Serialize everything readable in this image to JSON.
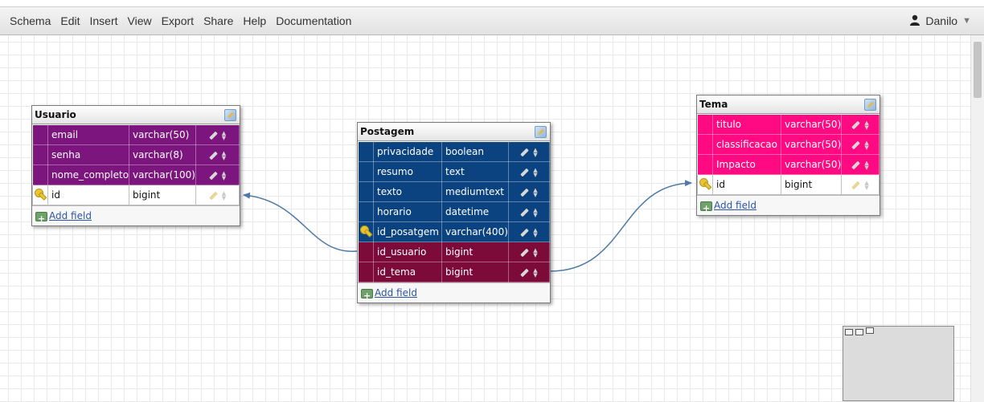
{
  "menu": {
    "items": [
      "Schema",
      "Edit",
      "Insert",
      "View",
      "Export",
      "Share",
      "Help",
      "Documentation"
    ],
    "user_name": "Danilo",
    "user_icon": "user-icon",
    "caret_icon": "caret-down-icon"
  },
  "colors": {
    "usuario_rows": "#7d157f",
    "postagem_rows": "#0b4280",
    "postagem_fk_rows": "#7d0b3a",
    "tema_rows": "#ff0a82",
    "connector": "#4d7aa6"
  },
  "tables": {
    "usuario": {
      "title": "Usuario",
      "fields": [
        {
          "name": "email",
          "type": "varchar(50)"
        },
        {
          "name": "senha",
          "type": "varchar(8)"
        },
        {
          "name": "nome_completo",
          "type": "varchar(100)"
        },
        {
          "name": "id",
          "type": "bigint",
          "primary_key": true
        }
      ],
      "add_field": "Add field"
    },
    "postagem": {
      "title": "Postagem",
      "fields": [
        {
          "name": "privacidade",
          "type": "boolean"
        },
        {
          "name": "resumo",
          "type": "text"
        },
        {
          "name": "texto",
          "type": "mediumtext"
        },
        {
          "name": "horario",
          "type": "datetime"
        },
        {
          "name": "id_posatgem",
          "type": "varchar(400)",
          "primary_key": true
        },
        {
          "name": "id_usuario",
          "type": "bigint",
          "foreign_key": true
        },
        {
          "name": "id_tema",
          "type": "bigint",
          "foreign_key": true
        }
      ],
      "add_field": "Add field"
    },
    "tema": {
      "title": "Tema",
      "fields": [
        {
          "name": "titulo",
          "type": "varchar(50)"
        },
        {
          "name": "classificacao",
          "type": "varchar(50)"
        },
        {
          "name": "Impacto",
          "type": "varchar(50)"
        },
        {
          "name": "id",
          "type": "bigint",
          "primary_key": true
        }
      ],
      "add_field": "Add field"
    }
  },
  "relations": [
    {
      "from": "postagem.id_usuario",
      "to": "usuario.id"
    },
    {
      "from": "postagem.id_tema",
      "to": "tema.id"
    }
  ]
}
